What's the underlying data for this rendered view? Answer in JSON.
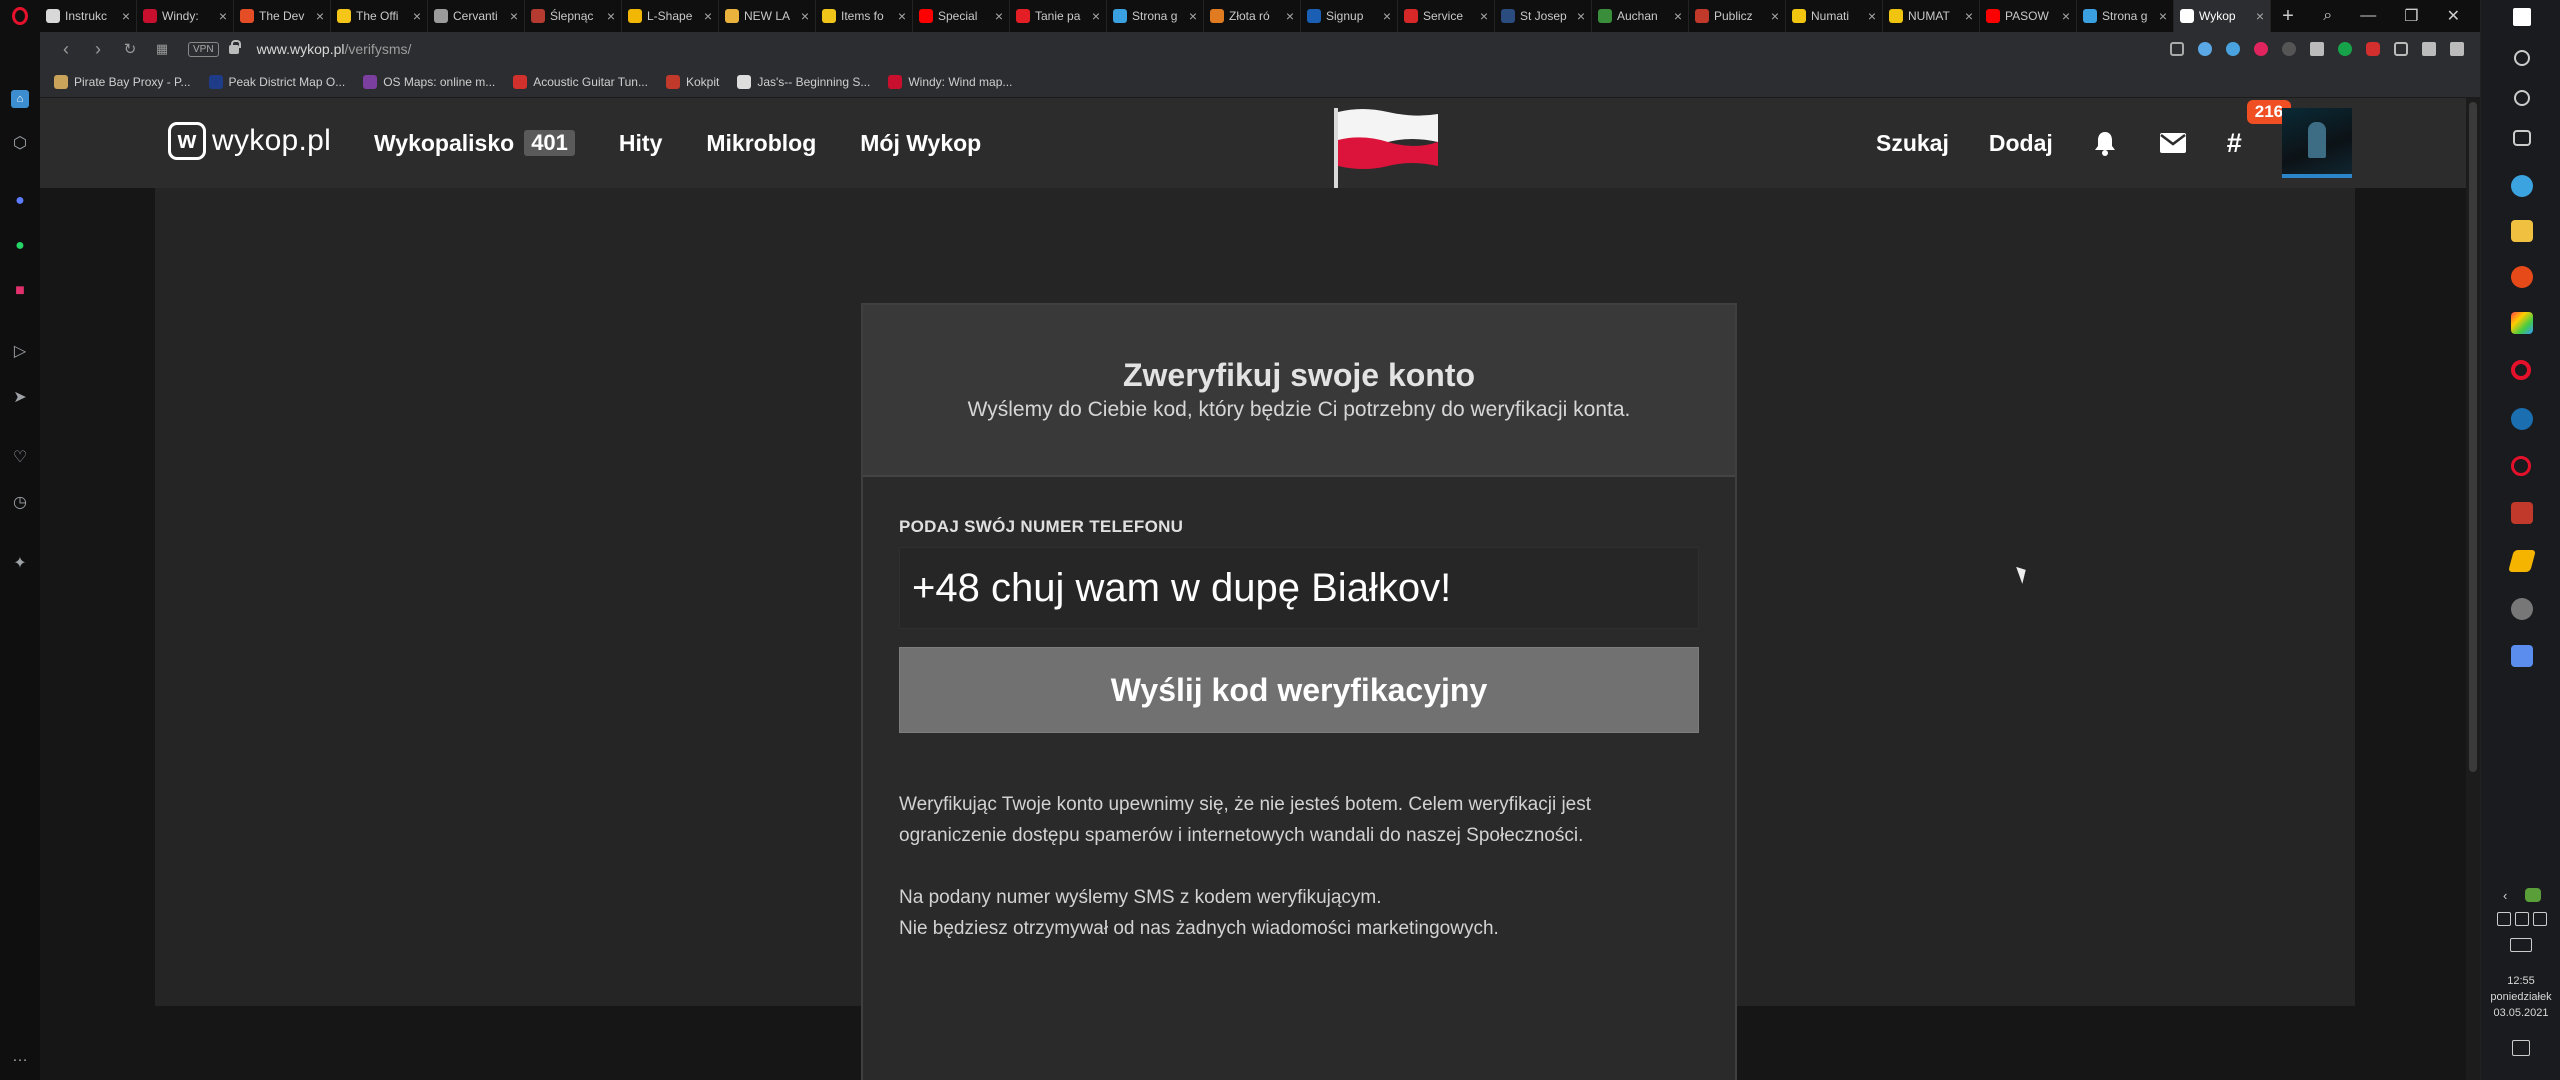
{
  "browser": {
    "tabs": [
      {
        "title": "Instrukc",
        "color": "#d8d8d8",
        "active": false
      },
      {
        "title": "Windy: ",
        "color": "#c8102e",
        "active": false
      },
      {
        "title": "The Dev",
        "color": "#e44d26",
        "active": false
      },
      {
        "title": "The Offi",
        "color": "#f5c518",
        "active": false
      },
      {
        "title": "Cervanti",
        "color": "#9b9b9b",
        "active": false
      },
      {
        "title": "Ślepnąc",
        "color": "#b53a2f",
        "active": false
      },
      {
        "title": "L-Shape",
        "color": "#f2b705",
        "active": false
      },
      {
        "title": "NEW LA",
        "color": "#e8b23c",
        "active": false
      },
      {
        "title": "Items fo",
        "color": "#f0c419",
        "active": false
      },
      {
        "title": "Special",
        "color": "#ff0000",
        "active": false
      },
      {
        "title": "Tanie pa",
        "color": "#e31e24",
        "active": false
      },
      {
        "title": "Strona g",
        "color": "#3aa0e0",
        "active": false
      },
      {
        "title": "Złota ró",
        "color": "#e07b21",
        "active": false
      },
      {
        "title": "Signup",
        "color": "#1a5fb4",
        "active": false
      },
      {
        "title": "Service",
        "color": "#d62828",
        "active": false
      },
      {
        "title": "St Josep",
        "color": "#2b4c7e",
        "active": false
      },
      {
        "title": "Auchan",
        "color": "#3a8d3a",
        "active": false
      },
      {
        "title": "Publicz",
        "color": "#c0392b",
        "active": false
      },
      {
        "title": "Numati",
        "color": "#f1c40f",
        "active": false
      },
      {
        "title": "NUMAT",
        "color": "#f1c40f",
        "active": false
      },
      {
        "title": "PASOW",
        "color": "#ff0000",
        "active": false
      },
      {
        "title": "Strona g",
        "color": "#3aa0e0",
        "active": false
      },
      {
        "title": "Wykop",
        "color": "#ffffff",
        "active": true
      }
    ],
    "url_host": "www.wykop.pl",
    "url_path": "/verifysms/",
    "vpn_label": "VPN",
    "bookmarks": [
      {
        "title": "Pirate Bay Proxy - P...",
        "color": "#c9a35a"
      },
      {
        "title": "Peak District Map O...",
        "color": "#1f3c88"
      },
      {
        "title": "OS Maps: online m...",
        "color": "#7b3fa0"
      },
      {
        "title": "Acoustic Guitar Tun...",
        "color": "#d0312d"
      },
      {
        "title": "Kokpit",
        "color": "#c0392b"
      },
      {
        "title": "Jas's-- Beginning S...",
        "color": "#dddddd"
      },
      {
        "title": "Windy: Wind map...",
        "color": "#c8102e"
      }
    ]
  },
  "site": {
    "logo_text": "wykop.pl",
    "nav": {
      "wykopalisko": "Wykopalisko",
      "wykopalisko_count": "401",
      "hity": "Hity",
      "mikroblog": "Mikroblog",
      "moj_wykop": "Mój Wykop"
    },
    "search": "Szukaj",
    "add": "Dodaj",
    "notifications_count": "216"
  },
  "verify": {
    "title": "Zweryfikuj swoje konto",
    "subtitle": "Wyślemy do Ciebie kod, który będzie Ci potrzebny do weryfikacji konta.",
    "phone_label": "PODAJ SWÓJ NUMER TELEFONU",
    "phone_value": "+48 chuj wam w dupę Białkov!",
    "submit": "Wyślij kod weryfikacyjny",
    "info1": "Weryfikując Twoje konto upewnimy się, że nie jesteś botem. Celem weryfikacji jest ograniczenie dostępu spamerów i internetowych wandali do naszej Społeczności.",
    "info2_line1": "Na podany numer wyślemy SMS z kodem weryfikującym.",
    "info2_line2": "Nie będziesz otrzymywał od nas żadnych wiadomości marketingowych."
  },
  "system": {
    "time": "12:55",
    "day": "poniedziałek",
    "date": "03.05.2021"
  }
}
